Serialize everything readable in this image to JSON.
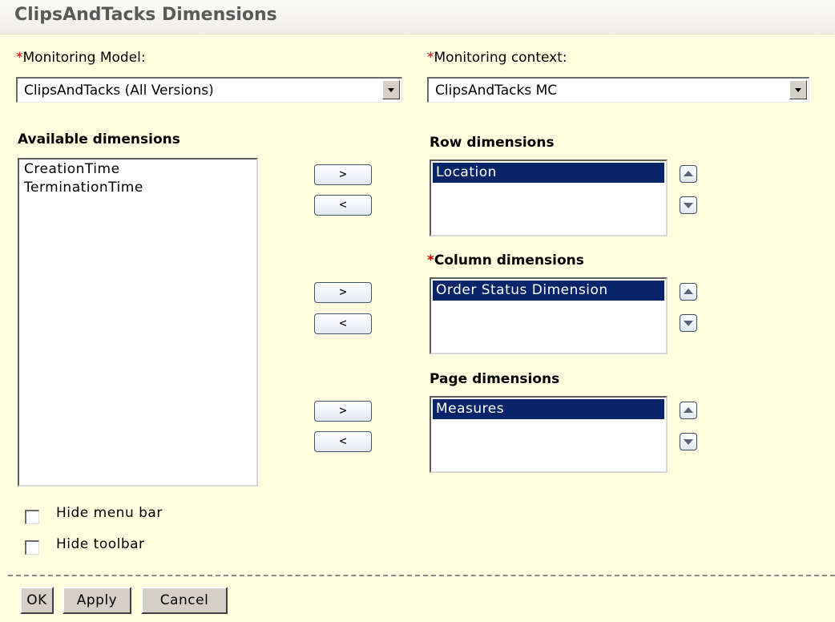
{
  "title": "ClipsAndTacks Dimensions",
  "monitoring_model": {
    "required_mark": "*",
    "label": "Monitoring Model:",
    "value": "ClipsAndTacks (All Versions)"
  },
  "monitoring_context": {
    "required_mark": "*",
    "label": "Monitoring context:",
    "value": "ClipsAndTacks MC"
  },
  "available": {
    "label": "Available dimensions",
    "items": [
      "CreationTime",
      "TerminationTime"
    ]
  },
  "row": {
    "label": "Row dimensions",
    "items": [
      "Location"
    ]
  },
  "column": {
    "required_mark": "*",
    "label": "Column dimensions",
    "items": [
      "Order Status Dimension"
    ]
  },
  "page": {
    "label": "Page dimensions",
    "items": [
      "Measures"
    ]
  },
  "move_buttons": {
    "add": ">",
    "remove": "<"
  },
  "options": {
    "hide_menu_bar": {
      "label": "Hide menu bar",
      "checked": false
    },
    "hide_toolbar": {
      "label": "Hide toolbar",
      "checked": false
    }
  },
  "buttons": {
    "ok": "OK",
    "apply": "Apply",
    "cancel": "Cancel"
  }
}
